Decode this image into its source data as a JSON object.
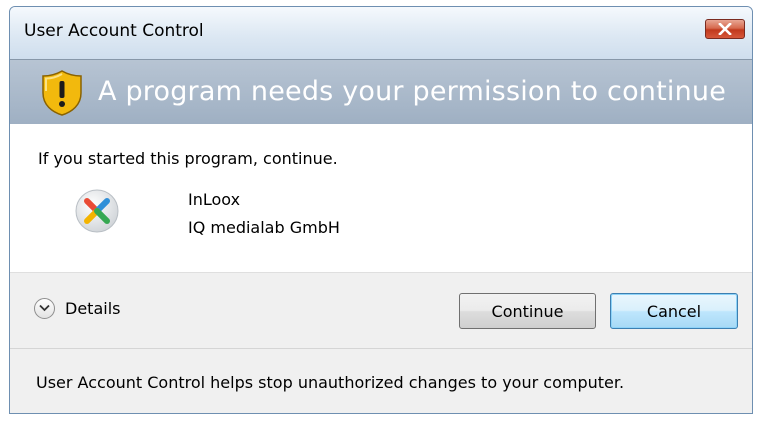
{
  "window": {
    "title": "User Account Control"
  },
  "header": {
    "text": "A program needs your permission to continue",
    "band_color": "#a9b8c8"
  },
  "content": {
    "intro": "If you started this program, continue.",
    "program_name": "InLoox",
    "publisher": "IQ medialab GmbH"
  },
  "actions": {
    "details_label": "Details",
    "continue_label": "Continue",
    "cancel_label": "Cancel"
  },
  "footer": {
    "text": "User Account Control helps stop unauthorized changes to your computer."
  },
  "icons": {
    "close": "close-icon",
    "shield": "uac-shield-icon",
    "program": "inloox-logo-icon",
    "details": "chevron-down-icon"
  },
  "colors": {
    "close_button": "#c84a2f",
    "cancel_focus_border": "#3c7fb1",
    "shield_gold": "#f2b90d",
    "shield_blue": "#3a6fb0"
  }
}
